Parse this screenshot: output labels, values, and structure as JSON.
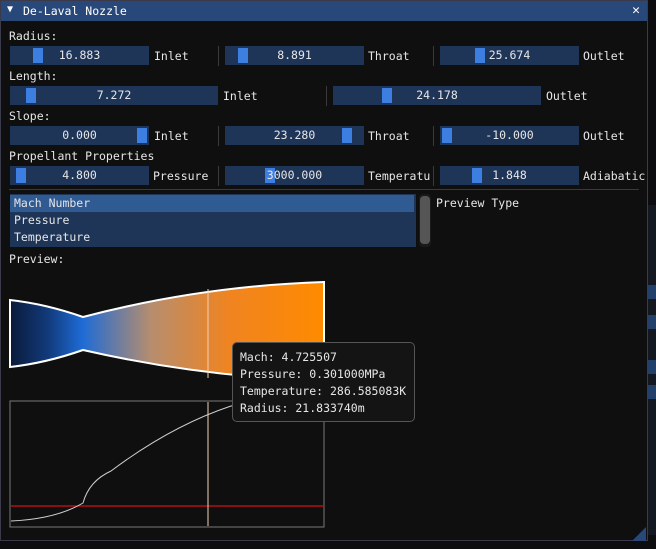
{
  "window": {
    "title": "De-Laval Nozzle"
  },
  "radius": {
    "heading": "Radius:",
    "inlet": {
      "value": "16.883",
      "label": "Inlet",
      "fraction": 0.14
    },
    "throat": {
      "value": "8.891",
      "label": "Throat",
      "fraction": 0.1
    },
    "outlet": {
      "value": "25.674",
      "label": "Outlet",
      "fraction": 0.27
    }
  },
  "length": {
    "heading": "Length:",
    "inlet": {
      "value": "7.272",
      "label": "Inlet",
      "fraction": 0.07
    },
    "outlet": {
      "value": "24.178",
      "label": "Outlet",
      "fraction": 0.24
    }
  },
  "slope": {
    "heading": "Slope:",
    "inlet": {
      "value": "0.000",
      "label": "Inlet",
      "fraction": 1.0
    },
    "throat": {
      "value": "23.280",
      "label": "Throat",
      "fraction": 0.93
    },
    "outlet": {
      "value": "-10.000",
      "label": "Outlet",
      "fraction": 0.0
    }
  },
  "propellant": {
    "heading": "Propellant Properties",
    "pressure": {
      "value": "4.800",
      "label": "Pressure",
      "fraction": 0.04
    },
    "temperature": {
      "value": "3000.000",
      "label": "Temperatu",
      "fraction": 0.3
    },
    "adiabatic": {
      "value": "1.848",
      "label": "Adiabatic",
      "fraction": 0.26
    }
  },
  "preview_type": {
    "label": "Preview Type",
    "options": [
      "Mach Number",
      "Pressure",
      "Temperature"
    ],
    "selected": "Mach Number"
  },
  "preview": {
    "label": "Preview:"
  },
  "tooltip": {
    "mach": "Mach: 4.725507",
    "pressure": "Pressure: 0.301000MPa",
    "temperature": "Temperature: 286.585083K",
    "radius": "Radius: 21.833740m"
  },
  "colors": {
    "title_bar": "#29487a",
    "frame": "#1e3558",
    "grab": "#3d7fe0",
    "selected": "#2f5a92",
    "gradient_start": "#0a1a3a",
    "gradient_throat": "#1e6bd6",
    "gradient_end": "#ff8a00",
    "reference_line": "#d01010"
  },
  "icons": {
    "collapse": "triangle-down-icon",
    "close": "close-icon"
  }
}
